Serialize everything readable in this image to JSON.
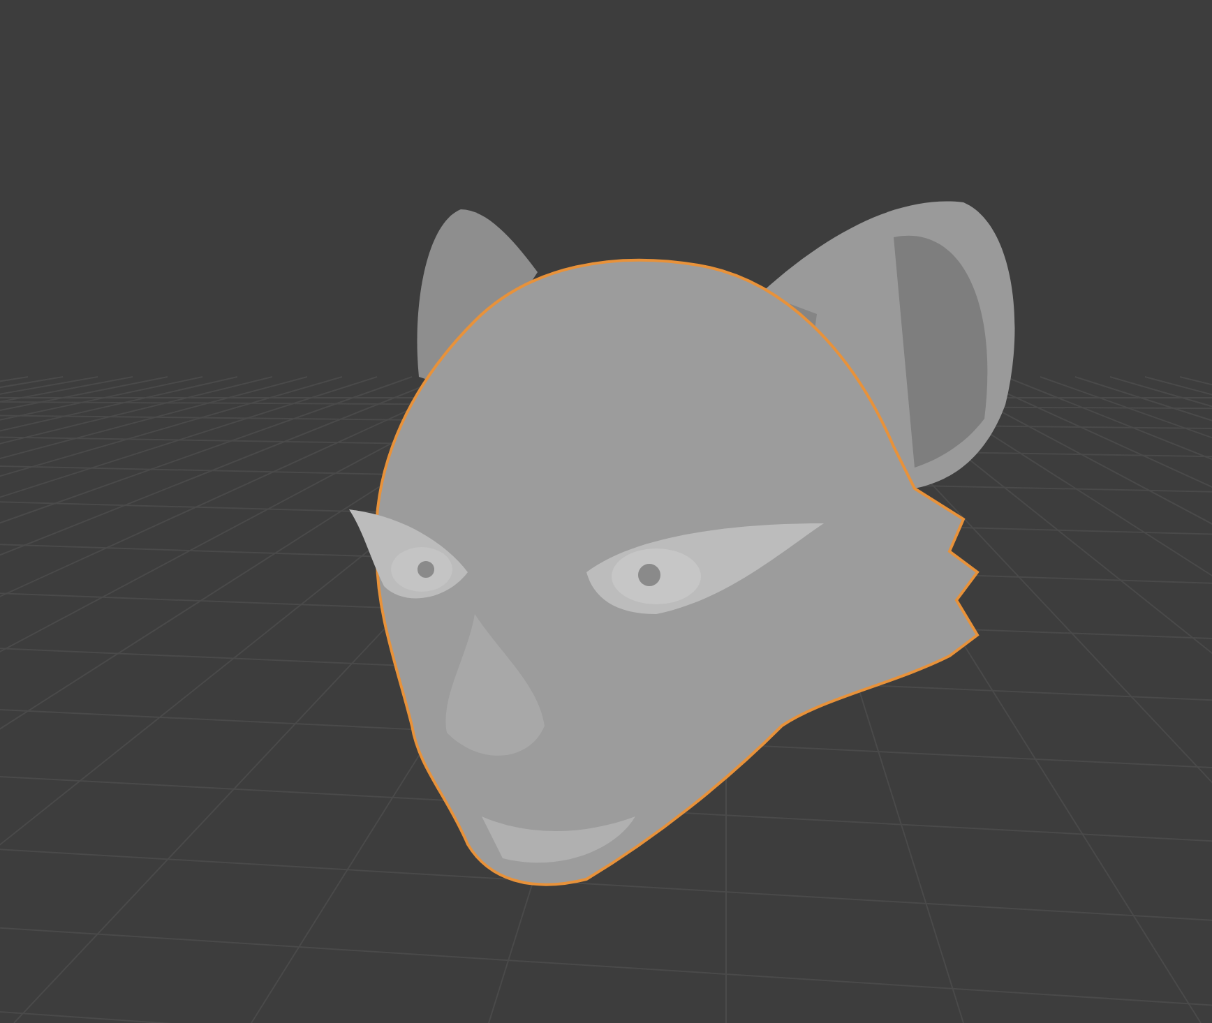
{
  "viewport": {
    "model_selected": true
  }
}
